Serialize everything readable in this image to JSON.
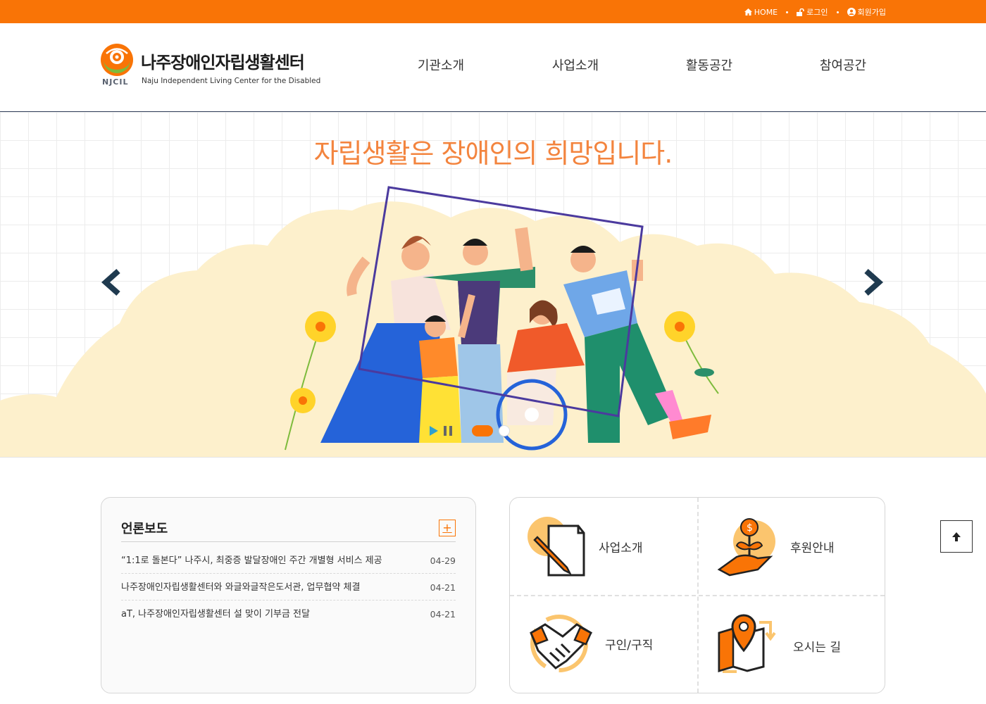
{
  "topbar": {
    "links": [
      {
        "icon": "home-icon",
        "label": "HOME"
      },
      {
        "icon": "unlock-icon",
        "label": "로그인"
      },
      {
        "icon": "user-circle-icon",
        "label": "회원가입"
      }
    ]
  },
  "header": {
    "logo_abbr": "NJCIL",
    "logo_name": "나주장애인자립생활센터",
    "logo_eng": "Naju Independent Living Center for the Disabled",
    "nav": [
      "기관소개",
      "사업소개",
      "활동공간",
      "참여공간"
    ]
  },
  "hero": {
    "title": "자립생활은 장애인의 희망입니다.",
    "prev_icon": "chevron-left-icon",
    "next_icon": "chevron-right-icon",
    "controls": [
      "play-icon",
      "pause-icon"
    ]
  },
  "board": {
    "title": "언론보도",
    "more_label": "+",
    "items": [
      {
        "title": "“1:1로 돌본다” 나주시, 최중증 발달장애인 주간 개별형 서비스 제공",
        "date": "04-29"
      },
      {
        "title": "나주장애인자립생활센터와 와글와글작은도서관, 업무협약 체결",
        "date": "04-21"
      },
      {
        "title": "aT, 나주장애인자립생활센터 설 맞이 기부금 전달",
        "date": "04-21"
      }
    ]
  },
  "quick": {
    "items": [
      {
        "label": "사업소개",
        "icon": "pencil-document-icon"
      },
      {
        "label": "후원안내",
        "icon": "donation-plant-icon"
      },
      {
        "label": "구인/구직",
        "icon": "handshake-icon"
      },
      {
        "label": "오시는 길",
        "icon": "map-pin-icon"
      }
    ]
  },
  "colors": {
    "accent": "#f97406",
    "hero_title": "#f3843e",
    "navy": "#1f3a4f"
  }
}
